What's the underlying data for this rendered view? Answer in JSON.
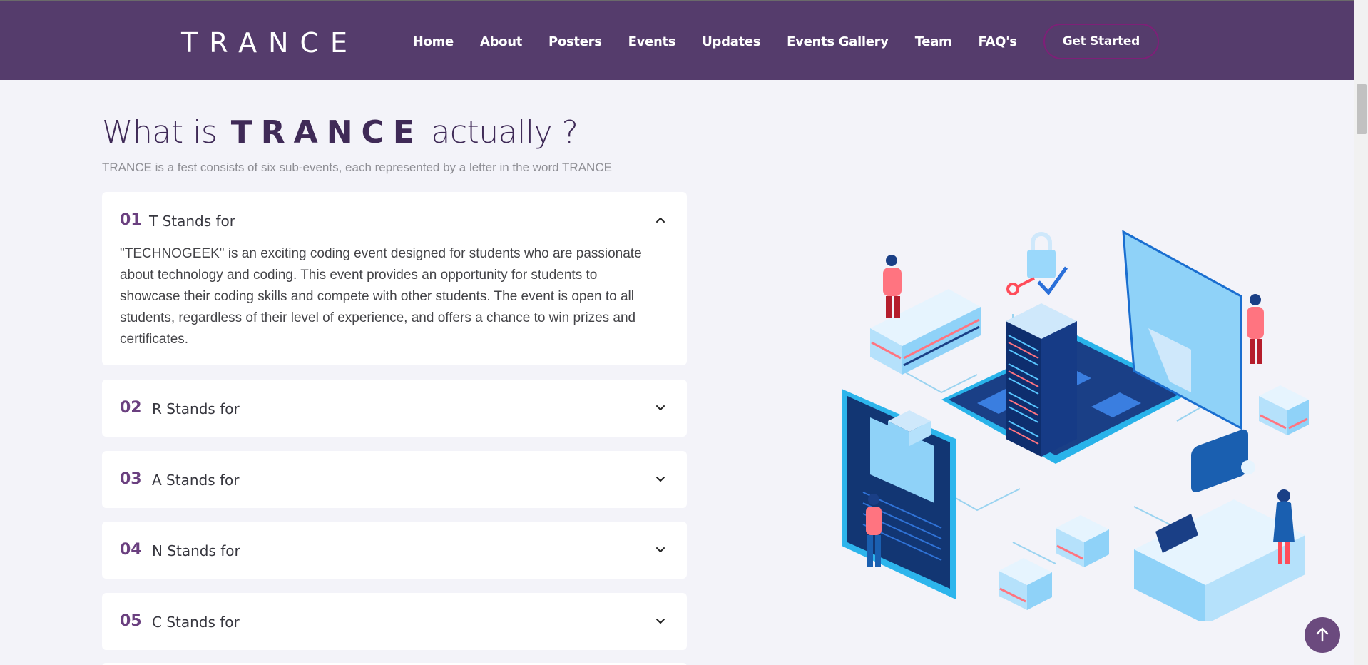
{
  "header": {
    "logo": "TRANCE",
    "nav": [
      "Home",
      "About",
      "Posters",
      "Events",
      "Updates",
      "Events Gallery",
      "Team",
      "FAQ's"
    ],
    "cta": "Get Started"
  },
  "section": {
    "title_prefix": "What is",
    "title_brand": "TRANCE",
    "title_suffix": "actually ?",
    "subtitle": "TRANCE is a fest consists of six sub-events, each represented by a letter in the word TRANCE"
  },
  "accordion": [
    {
      "num": "01",
      "label": "T Stands for",
      "expanded": true,
      "body": "\"TECHNOGEEK\" is an exciting coding event designed for students who are passionate about technology and coding. This event provides an opportunity for students to showcase their coding skills and compete with other students. The event is open to all students, regardless of their level of experience, and offers a chance to win prizes and certificates."
    },
    {
      "num": "02",
      "label": "R Stands for",
      "expanded": false
    },
    {
      "num": "03",
      "label": "A Stands for",
      "expanded": false
    },
    {
      "num": "04",
      "label": "N Stands for",
      "expanded": false
    },
    {
      "num": "05",
      "label": "C Stands for",
      "expanded": false
    }
  ],
  "icons": {
    "expanded_chevron": "chevron-up-icon",
    "collapsed_chevron": "chevron-down-icon",
    "back_to_top": "arrow-up-icon"
  },
  "colors": {
    "header_bg": "#553c6c",
    "accent": "#6a3f7f",
    "cta_border": "#7f1f78",
    "page_bg": "#f3f3f9",
    "back_top_bg": "#6b4a7e"
  }
}
